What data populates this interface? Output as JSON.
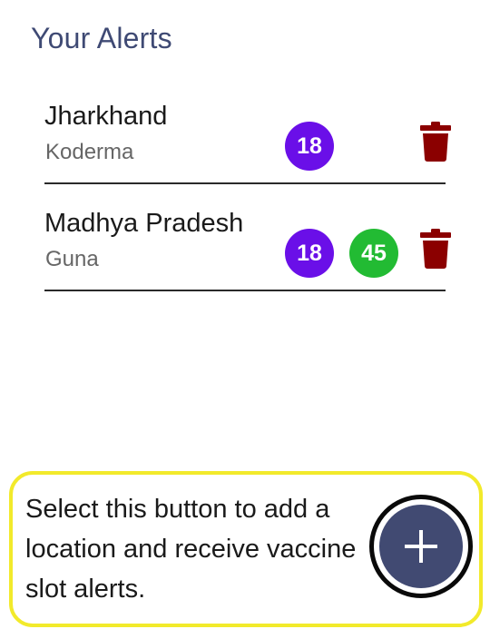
{
  "page": {
    "title": "Your Alerts"
  },
  "alerts": [
    {
      "state": "Jharkhand",
      "district": "Koderma",
      "age_badges": [
        "18"
      ]
    },
    {
      "state": "Madhya Pradesh",
      "district": "Guna",
      "age_badges": [
        "18",
        "45"
      ]
    }
  ],
  "icons": {
    "delete": "trash-icon",
    "add": "plus-icon"
  },
  "coach_mark": {
    "text": "Select this button to add a location and receive vaccine slot alerts."
  },
  "colors": {
    "title": "#3f4a74",
    "badge_18": "#6a0fe8",
    "badge_45": "#22bb33",
    "delete_icon": "#8b0000",
    "fab": "#414a72",
    "coach_border": "#f2ea2b"
  }
}
